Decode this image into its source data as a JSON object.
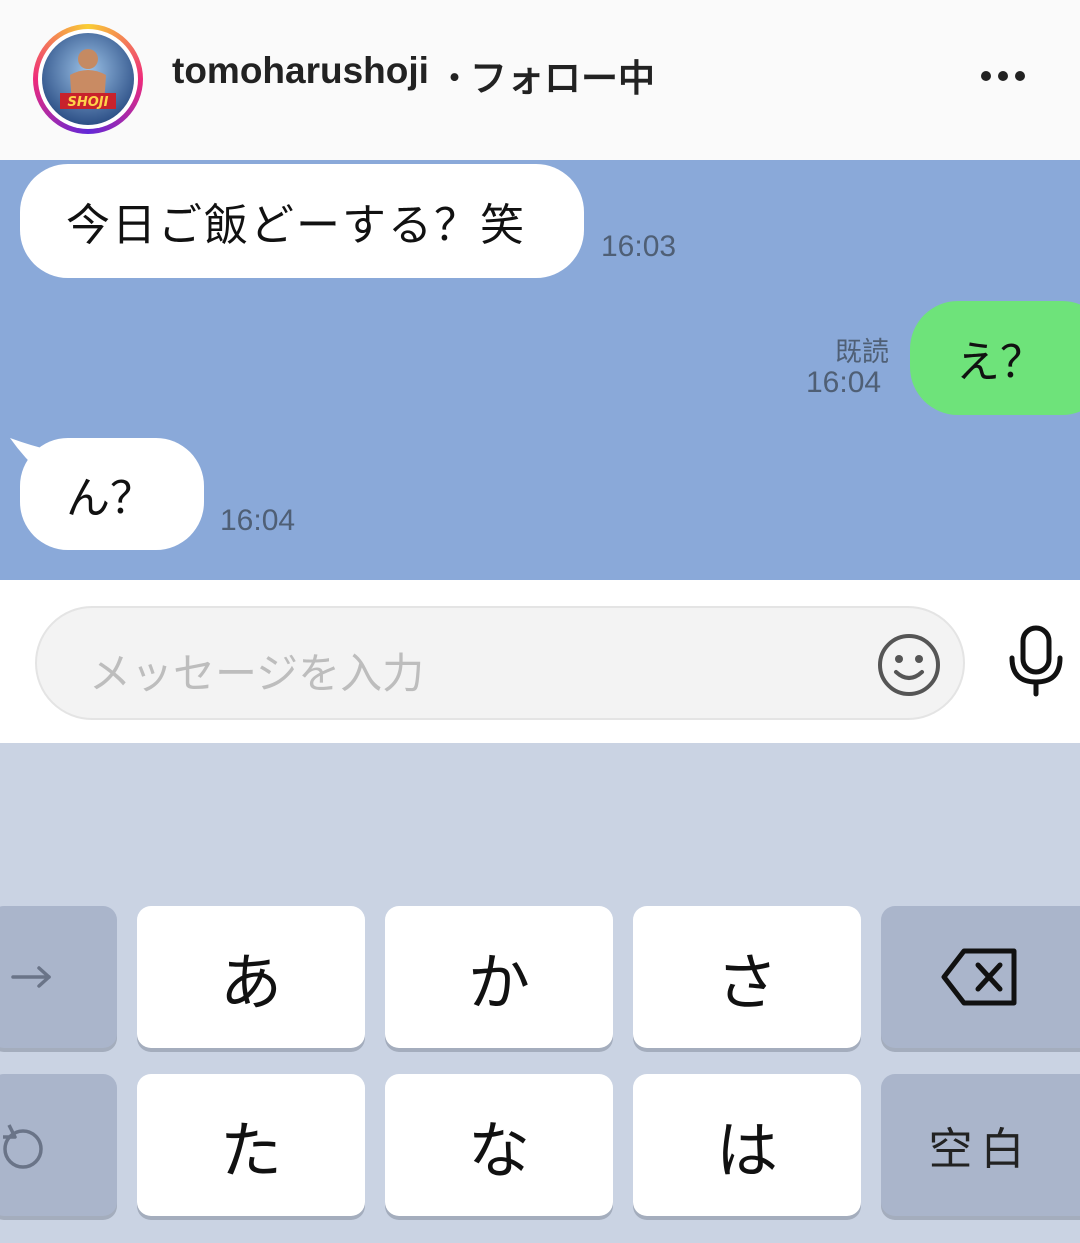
{
  "header": {
    "username": "tomoharushoji",
    "separator": "・",
    "follow_status": "フォロー中",
    "more_icon": "ellipsis-horizontal-icon"
  },
  "chat": {
    "messages": [
      {
        "direction": "incoming",
        "text": "今日ご飯どーする？笑",
        "time": "16:03"
      },
      {
        "direction": "outgoing",
        "text": "え？",
        "read_label": "既読",
        "time": "16:04"
      },
      {
        "direction": "incoming",
        "text": "ん？",
        "time": "16:04"
      }
    ],
    "colors": {
      "background": "#8aa9d9",
      "outgoing_bubble": "#6ee37a",
      "incoming_bubble": "#ffffff"
    }
  },
  "input": {
    "placeholder": "メッセージを入力",
    "emoji_icon": "smiley-icon",
    "mic_icon": "microphone-icon"
  },
  "keyboard": {
    "row1": [
      "あ",
      "か",
      "さ"
    ],
    "row2": [
      "た",
      "な",
      "は"
    ],
    "space_label": "空白",
    "backspace_icon": "backspace-icon",
    "arrow_icon": "arrow-right-icon",
    "undo_icon": "undo-icon"
  }
}
